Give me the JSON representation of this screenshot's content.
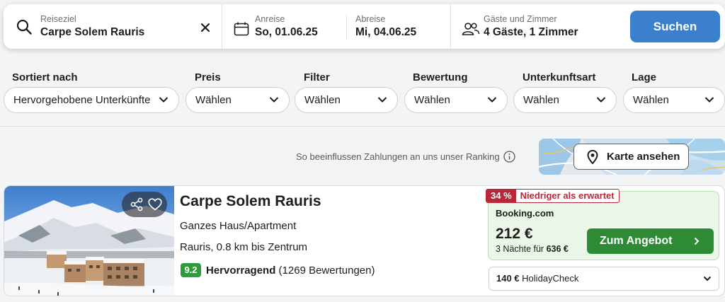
{
  "search": {
    "destination_label": "Reiseziel",
    "destination_value": "Carpe Solem Rauris",
    "checkin_label": "Anreise",
    "checkin_value": "So, 01.06.25",
    "checkout_label": "Abreise",
    "checkout_value": "Mi, 04.06.25",
    "guests_label": "Gäste und Zimmer",
    "guests_value": "4 Gäste, 1 Zimmer",
    "button_label": "Suchen",
    "button_color": "#3b80cf"
  },
  "filters": {
    "sort": {
      "label": "Sortiert nach",
      "value": "Hervorgehobene Unterkünfte"
    },
    "price": {
      "label": "Preis",
      "value": "Wählen"
    },
    "filter": {
      "label": "Filter",
      "value": "Wählen"
    },
    "rating": {
      "label": "Bewertung",
      "value": "Wählen"
    },
    "accommodation": {
      "label": "Unterkunftsart",
      "value": "Wählen"
    },
    "location": {
      "label": "Lage",
      "value": "Wählen"
    }
  },
  "ranking_note": "So beeinflussen Zahlungen an uns unser Ranking",
  "map_button_label": "Karte ansehen",
  "hotel": {
    "name": "Carpe Solem Rauris",
    "type": "Ganzes Haus/Apartment",
    "location": "Rauris, 0.8 km bis Zentrum",
    "rating_score": "9.2",
    "rating_word": "Hervorragend",
    "rating_count": "(1269 Bewertungen)",
    "rating_color": "#2e9c3b"
  },
  "deal": {
    "discount_percent": "34 %",
    "discount_label": "Niedriger als erwartet",
    "provider": "Booking.com",
    "price": "212 €",
    "nights_text": "3 Nächte für",
    "total_price": "636 €",
    "offer_button": "Zum Angebot",
    "offer_color": "#2f8a35",
    "alt_price": "140 €",
    "alt_provider": "HolidayCheck"
  },
  "icons": [
    "search-icon",
    "close-icon",
    "calendar-icon",
    "guests-icon",
    "chevron-down-icon",
    "info-icon",
    "map-pin-icon",
    "share-icon",
    "heart-icon",
    "chevron-right-icon"
  ]
}
